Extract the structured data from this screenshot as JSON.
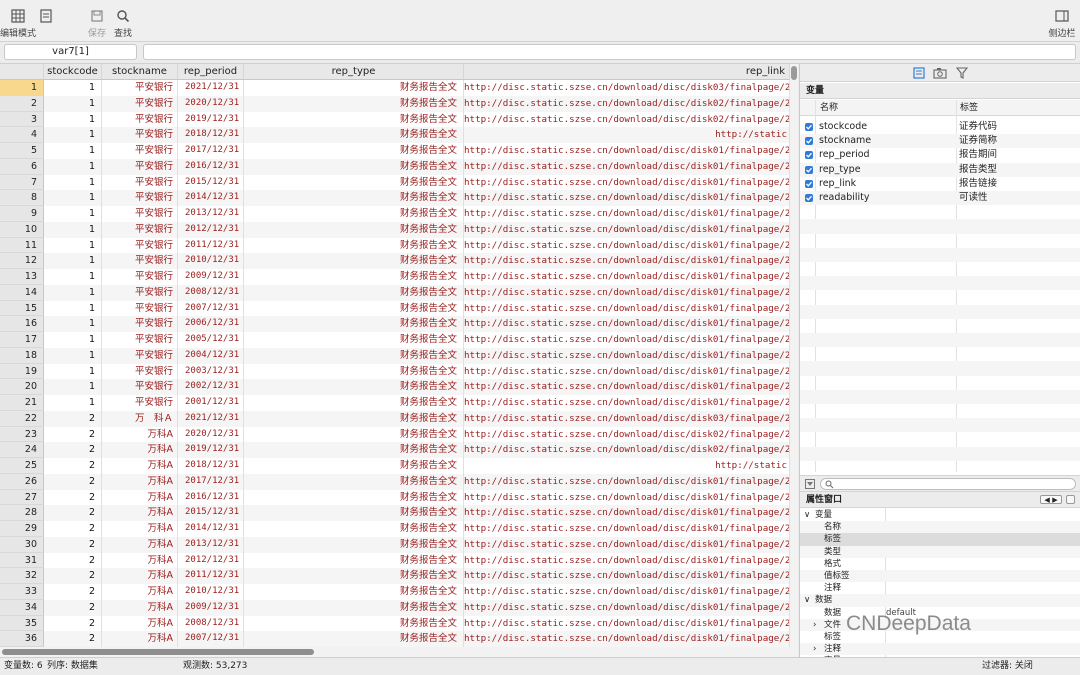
{
  "toolbar": {
    "edit_mode_label": "编辑模式",
    "save_label": "保存",
    "find_label": "查找",
    "sidebar_label": "侧边栏"
  },
  "cmdbar": {
    "cell_ref": "var7[1]",
    "input_value": ""
  },
  "grid": {
    "columns": [
      "stockcode",
      "stockname",
      "rep_period",
      "rep_type",
      "rep_link"
    ],
    "rows": [
      [
        "1",
        "1",
        "平安银行",
        "2021/12/31",
        "财务报告全文",
        "http://disc.static.szse.cn/download/disc/disk03/finalpage/2"
      ],
      [
        "2",
        "1",
        "平安银行",
        "2020/12/31",
        "财务报告全文",
        "http://disc.static.szse.cn/download/disc/disk02/finalpage/2"
      ],
      [
        "3",
        "1",
        "平安银行",
        "2019/12/31",
        "财务报告全文",
        "http://disc.static.szse.cn/download/disc/disk02/finalpage/2"
      ],
      [
        "4",
        "1",
        "平安银行",
        "2018/12/31",
        "财务报告全文",
        "http://static"
      ],
      [
        "5",
        "1",
        "平安银行",
        "2017/12/31",
        "财务报告全文",
        "http://disc.static.szse.cn/download/disc/disk01/finalpage/2"
      ],
      [
        "6",
        "1",
        "平安银行",
        "2016/12/31",
        "财务报告全文",
        "http://disc.static.szse.cn/download/disc/disk01/finalpage/2"
      ],
      [
        "7",
        "1",
        "平安银行",
        "2015/12/31",
        "财务报告全文",
        "http://disc.static.szse.cn/download/disc/disk01/finalpage/2"
      ],
      [
        "8",
        "1",
        "平安银行",
        "2014/12/31",
        "财务报告全文",
        "http://disc.static.szse.cn/download/disc/disk01/finalpage/2"
      ],
      [
        "9",
        "1",
        "平安银行",
        "2013/12/31",
        "财务报告全文",
        "http://disc.static.szse.cn/download/disc/disk01/finalpage/2"
      ],
      [
        "10",
        "1",
        "平安银行",
        "2012/12/31",
        "财务报告全文",
        "http://disc.static.szse.cn/download/disc/disk01/finalpage/2"
      ],
      [
        "11",
        "1",
        "平安银行",
        "2011/12/31",
        "财务报告全文",
        "http://disc.static.szse.cn/download/disc/disk01/finalpage/2"
      ],
      [
        "12",
        "1",
        "平安银行",
        "2010/12/31",
        "财务报告全文",
        "http://disc.static.szse.cn/download/disc/disk01/finalpage/2"
      ],
      [
        "13",
        "1",
        "平安银行",
        "2009/12/31",
        "财务报告全文",
        "http://disc.static.szse.cn/download/disc/disk01/finalpage/2"
      ],
      [
        "14",
        "1",
        "平安银行",
        "2008/12/31",
        "财务报告全文",
        "http://disc.static.szse.cn/download/disc/disk01/finalpage/2"
      ],
      [
        "15",
        "1",
        "平安银行",
        "2007/12/31",
        "财务报告全文",
        "http://disc.static.szse.cn/download/disc/disk01/finalpage/2"
      ],
      [
        "16",
        "1",
        "平安银行",
        "2006/12/31",
        "财务报告全文",
        "http://disc.static.szse.cn/download/disc/disk01/finalpage/2"
      ],
      [
        "17",
        "1",
        "平安银行",
        "2005/12/31",
        "财务报告全文",
        "http://disc.static.szse.cn/download/disc/disk01/finalpage/2"
      ],
      [
        "18",
        "1",
        "平安银行",
        "2004/12/31",
        "财务报告全文",
        "http://disc.static.szse.cn/download/disc/disk01/finalpage/2"
      ],
      [
        "19",
        "1",
        "平安银行",
        "2003/12/31",
        "财务报告全文",
        "http://disc.static.szse.cn/download/disc/disk01/finalpage/2"
      ],
      [
        "20",
        "1",
        "平安银行",
        "2002/12/31",
        "财务报告全文",
        "http://disc.static.szse.cn/download/disc/disk01/finalpage/2"
      ],
      [
        "21",
        "1",
        "平安银行",
        "2001/12/31",
        "财务报告全文",
        "http://disc.static.szse.cn/download/disc/disk01/finalpage/2"
      ],
      [
        "22",
        "2",
        "万　科Ａ",
        "2021/12/31",
        "财务报告全文",
        "http://disc.static.szse.cn/download/disc/disk03/finalpage/2"
      ],
      [
        "23",
        "2",
        "万科A",
        "2020/12/31",
        "财务报告全文",
        "http://disc.static.szse.cn/download/disc/disk02/finalpage/2"
      ],
      [
        "24",
        "2",
        "万科A",
        "2019/12/31",
        "财务报告全文",
        "http://disc.static.szse.cn/download/disc/disk02/finalpage/2"
      ],
      [
        "25",
        "2",
        "万科A",
        "2018/12/31",
        "财务报告全文",
        "http://static"
      ],
      [
        "26",
        "2",
        "万科A",
        "2017/12/31",
        "财务报告全文",
        "http://disc.static.szse.cn/download/disc/disk01/finalpage/2"
      ],
      [
        "27",
        "2",
        "万科A",
        "2016/12/31",
        "财务报告全文",
        "http://disc.static.szse.cn/download/disc/disk01/finalpage/2"
      ],
      [
        "28",
        "2",
        "万科A",
        "2015/12/31",
        "财务报告全文",
        "http://disc.static.szse.cn/download/disc/disk01/finalpage/2"
      ],
      [
        "29",
        "2",
        "万科A",
        "2014/12/31",
        "财务报告全文",
        "http://disc.static.szse.cn/download/disc/disk01/finalpage/2"
      ],
      [
        "30",
        "2",
        "万科A",
        "2013/12/31",
        "财务报告全文",
        "http://disc.static.szse.cn/download/disc/disk01/finalpage/2"
      ],
      [
        "31",
        "2",
        "万科A",
        "2012/12/31",
        "财务报告全文",
        "http://disc.static.szse.cn/download/disc/disk01/finalpage/2"
      ],
      [
        "32",
        "2",
        "万科A",
        "2011/12/31",
        "财务报告全文",
        "http://disc.static.szse.cn/download/disc/disk01/finalpage/2"
      ],
      [
        "33",
        "2",
        "万科A",
        "2010/12/31",
        "财务报告全文",
        "http://disc.static.szse.cn/download/disc/disk01/finalpage/2"
      ],
      [
        "34",
        "2",
        "万科A",
        "2009/12/31",
        "财务报告全文",
        "http://disc.static.szse.cn/download/disc/disk01/finalpage/2"
      ],
      [
        "35",
        "2",
        "万科A",
        "2008/12/31",
        "财务报告全文",
        "http://disc.static.szse.cn/download/disc/disk01/finalpage/2"
      ],
      [
        "36",
        "2",
        "万科A",
        "2007/12/31",
        "财务报告全文",
        "http://disc.static.szse.cn/download/disc/disk01/finalpage/2"
      ]
    ]
  },
  "variables_panel": {
    "title": "变量",
    "col_name": "名称",
    "col_label": "标签",
    "items": [
      {
        "name": "stockcode",
        "label": "证券代码"
      },
      {
        "name": "stockname",
        "label": "证券简称"
      },
      {
        "name": "rep_period",
        "label": "报告期间"
      },
      {
        "name": "rep_type",
        "label": "报告类型"
      },
      {
        "name": "rep_link",
        "label": "报告链接"
      },
      {
        "name": "readability",
        "label": "可读性"
      }
    ]
  },
  "properties_panel": {
    "title": "属性窗口",
    "rows": [
      {
        "key": "变量",
        "value": "",
        "group": true,
        "arrow": "∨"
      },
      {
        "key": "名称",
        "value": ""
      },
      {
        "key": "标签",
        "value": "",
        "selected": true
      },
      {
        "key": "类型",
        "value": ""
      },
      {
        "key": "格式",
        "value": ""
      },
      {
        "key": "值标签",
        "value": ""
      },
      {
        "key": "注释",
        "value": ""
      },
      {
        "key": "数据",
        "value": "",
        "group": true,
        "arrow": "∨"
      },
      {
        "key": "数据",
        "value": "default"
      },
      {
        "key": "文件",
        "value": "",
        "arrow": "›"
      },
      {
        "key": "标签",
        "value": ""
      },
      {
        "key": "注释",
        "value": "",
        "arrow": "›"
      },
      {
        "key": "变量",
        "value": ""
      }
    ]
  },
  "status_bar": {
    "vars": "变量数: 6",
    "order": "列序: 数据集",
    "obs": "观测数: 53,273",
    "filter": "过滤器: 关闭"
  },
  "watermark": "CNDeepData"
}
